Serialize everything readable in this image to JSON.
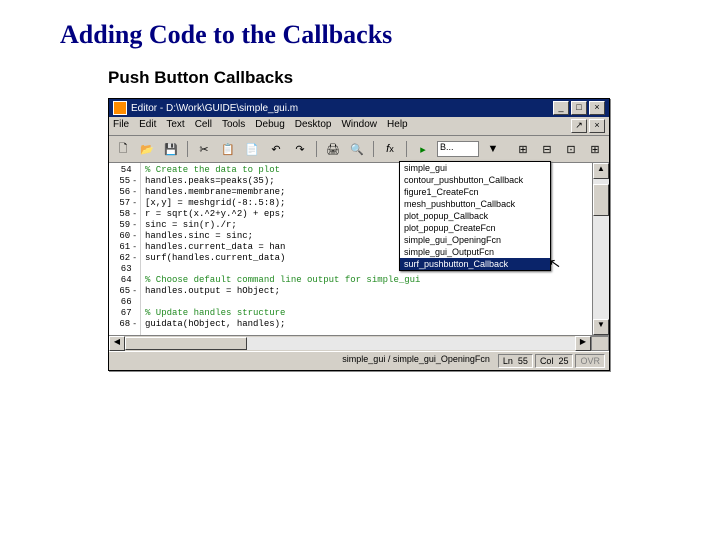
{
  "title": "Adding Code to the Callbacks",
  "subtitle": "Push Button Callbacks",
  "window": {
    "title": "Editor - D:\\Work\\GUIDE\\simple_gui.m",
    "btn_min": "_",
    "btn_max": "□",
    "btn_close": "×",
    "tab_x": "×",
    "tab_arrow": "↗"
  },
  "menu": {
    "file": "File",
    "edit": "Edit",
    "text": "Text",
    "cell": "Cell",
    "tools": "Tools",
    "debug": "Debug",
    "desktop": "Desktop",
    "window": "Window",
    "help": "Help"
  },
  "tools": {
    "new": "🗋",
    "open": "📂",
    "save": "💾",
    "cut": "✂",
    "copy": "📋",
    "paste": "📄",
    "undo": "↶",
    "redo": "↷",
    "print": "🖨",
    "find": "🔍",
    "fx": "f",
    "fxi": "x",
    "box": "B...",
    "run": "▸",
    "grid1": "⊞",
    "grid2": "⊟",
    "grid3": "⊡",
    "grid4": "⊞"
  },
  "lines": [
    {
      "n": "54",
      "d": "",
      "t": "% Create the data to plot",
      "c": true
    },
    {
      "n": "55",
      "d": "-",
      "t": "handles.peaks=peaks(35);",
      "c": false
    },
    {
      "n": "56",
      "d": "-",
      "t": "handles.membrane=membrane;",
      "c": false
    },
    {
      "n": "57",
      "d": "-",
      "t": "[x,y] = meshgrid(-8:.5:8);",
      "c": false
    },
    {
      "n": "58",
      "d": "-",
      "t": "r = sqrt(x.^2+y.^2) + eps;",
      "c": false
    },
    {
      "n": "59",
      "d": "-",
      "t": "sinc = sin(r)./r;",
      "c": false
    },
    {
      "n": "60",
      "d": "-",
      "t": "handles.sinc = sinc;",
      "c": false
    },
    {
      "n": "61",
      "d": "-",
      "t": "handles.current_data = han",
      "c": false
    },
    {
      "n": "62",
      "d": "-",
      "t": "surf(handles.current_data)",
      "c": false
    },
    {
      "n": "63",
      "d": "",
      "t": "",
      "c": false
    },
    {
      "n": "64",
      "d": "",
      "t": "% Choose default command line output for simple_gui",
      "c": true
    },
    {
      "n": "65",
      "d": "-",
      "t": "handles.output = hObject;",
      "c": false
    },
    {
      "n": "66",
      "d": "",
      "t": "",
      "c": false
    },
    {
      "n": "67",
      "d": "",
      "t": "% Update handles structure",
      "c": true
    },
    {
      "n": "68",
      "d": "-",
      "t": "guidata(hObject, handles);",
      "c": false
    }
  ],
  "dropdown": [
    "simple_gui",
    "contour_pushbutton_Callback",
    "figure1_CreateFcn",
    "mesh_pushbutton_Callback",
    "plot_popup_Callback",
    "plot_popup_CreateFcn",
    "simple_gui_OpeningFcn",
    "simple_gui_OutputFcn",
    "surf_pushbutton_Callback"
  ],
  "status": {
    "path": "simple_gui / simple_gui_OpeningFcn",
    "ln_label": "Ln",
    "ln": "55",
    "col_label": "Col",
    "col": "25",
    "ovr": "OVR"
  },
  "arrows": {
    "up": "▲",
    "down": "▼",
    "left": "◀",
    "right": "▶"
  },
  "cursor": "↖"
}
